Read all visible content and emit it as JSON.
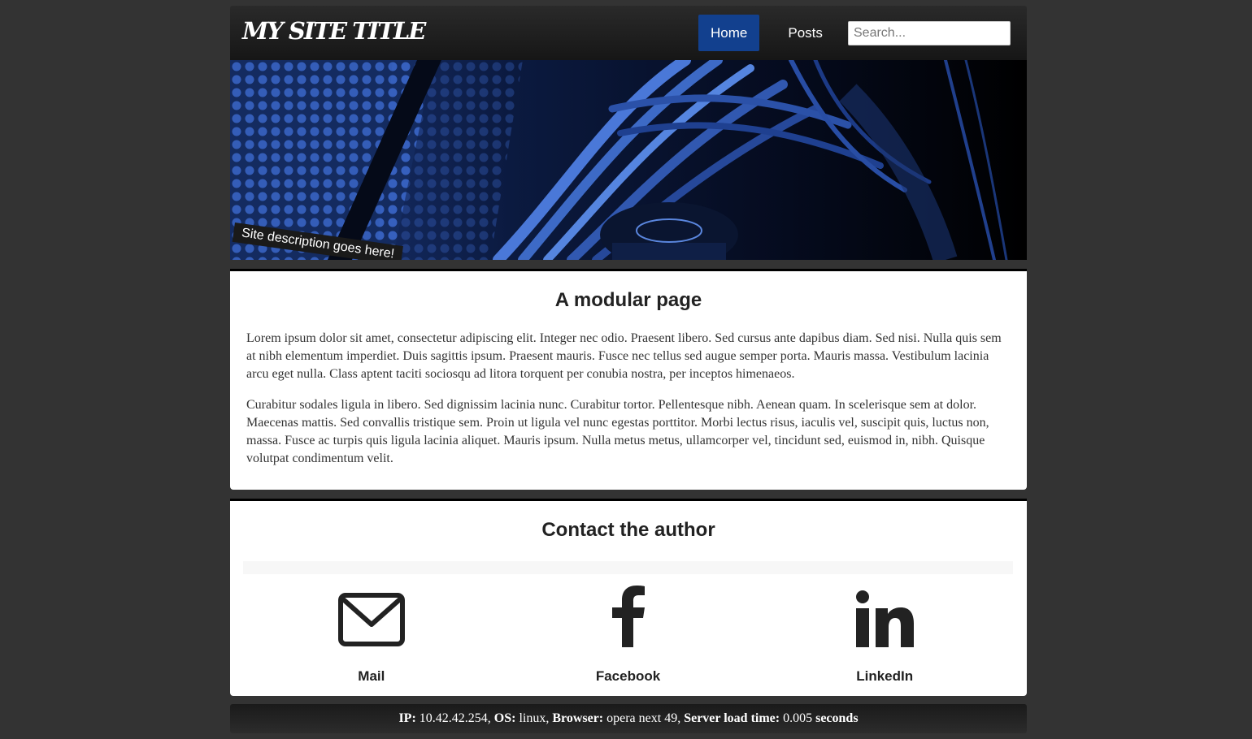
{
  "header": {
    "site_title": "MY SITE TITLE",
    "nav": [
      {
        "label": "Home",
        "active": true
      },
      {
        "label": "Posts",
        "active": false
      }
    ],
    "search_placeholder": "Search..."
  },
  "banner": {
    "tagline": "Site description goes here!",
    "accent_color": "#2a56b8"
  },
  "main": {
    "title": "A modular page",
    "paragraphs": [
      "Lorem ipsum dolor sit amet, consectetur adipiscing elit. Integer nec odio. Praesent libero. Sed cursus ante dapibus diam. Sed nisi. Nulla quis sem at nibh elementum imperdiet. Duis sagittis ipsum. Praesent mauris. Fusce nec tellus sed augue semper porta. Mauris massa. Vestibulum lacinia arcu eget nulla. Class aptent taciti sociosqu ad litora torquent per conubia nostra, per inceptos himenaeos.",
      "Curabitur sodales ligula in libero. Sed dignissim lacinia nunc. Curabitur tortor. Pellentesque nibh. Aenean quam. In scelerisque sem at dolor. Maecenas mattis. Sed convallis tristique sem. Proin ut ligula vel nunc egestas porttitor. Morbi lectus risus, iaculis vel, suscipit quis, luctus non, massa. Fusce ac turpis quis ligula lacinia aliquet. Mauris ipsum. Nulla metus metus, ullamcorper vel, tincidunt sed, euismod in, nibh. Quisque volutpat condimentum velit."
    ]
  },
  "contact": {
    "title": "Contact the author",
    "items": [
      {
        "label": "Mail",
        "icon": "mail-icon"
      },
      {
        "label": "Facebook",
        "icon": "facebook-icon"
      },
      {
        "label": "LinkedIn",
        "icon": "linkedin-icon"
      }
    ]
  },
  "footer": {
    "ip_label": "IP:",
    "ip_value": "10.42.42.254,",
    "os_label": "OS:",
    "os_value": "linux,",
    "browser_label": "Browser:",
    "browser_value": "opera next 49,",
    "load_label": "Server load time:",
    "load_value": "0.005",
    "load_unit": "seconds"
  },
  "colors": {
    "page_bg": "#333333",
    "nav_active": "#12408e",
    "icon": "#222222"
  }
}
